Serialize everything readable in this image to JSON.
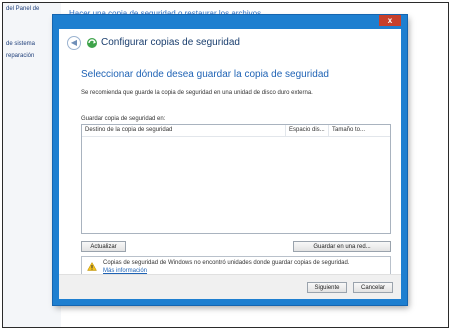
{
  "background_window": {
    "sidebar_links": [
      "del Panel de",
      "de sistema",
      "reparación"
    ],
    "title": "Hacer una copia de seguridad o restaurar los archivos"
  },
  "dialog": {
    "close_label": "x",
    "wizard_title": "Configurar copias de seguridad",
    "heading": "Seleccionar dónde desea guardar la copia de seguridad",
    "subtext": "Se recomienda que guarde la copia de seguridad en una unidad de disco duro externa.",
    "list_label": "Guardar copia de seguridad en:",
    "columns": [
      "Destino de la copia de seguridad",
      "Espacio dis...",
      "Tamaño to..."
    ],
    "refresh_label": "Actualizar",
    "network_label": "Guardar en una red...",
    "warning_text": "Copias de seguridad de Windows no encontró unidades donde guardar copias de seguridad.",
    "warning_link": "Más información",
    "next_label": "Siguiente",
    "cancel_label": "Cancelar"
  },
  "colors": {
    "dialog_frame": "#1e7fd0",
    "heading": "#1f63b5",
    "close": "#c7402c"
  }
}
